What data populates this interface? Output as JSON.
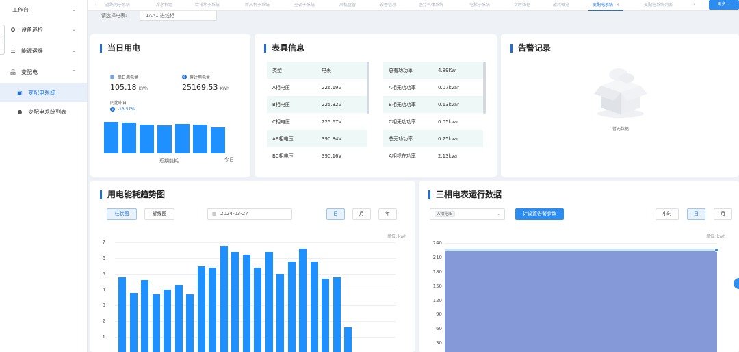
{
  "sidebar": {
    "workbench": "工作台",
    "items": [
      {
        "label": "设备巡检",
        "icon": "gear-icon"
      },
      {
        "label": "能源运维",
        "icon": "list-icon"
      },
      {
        "label": "变配电",
        "icon": "network-icon"
      }
    ],
    "sub_items": [
      {
        "label": "变配电系统",
        "active": true
      },
      {
        "label": "变配电系统列表",
        "active": false
      }
    ]
  },
  "tabs": [
    "道路网子系统",
    "冷水机组",
    "给排水子系统",
    "新风机子系统",
    "空调子系统",
    "风机盘管",
    "设备信息",
    "医疗气体系统",
    "电梯子系统",
    "实时数据",
    "能耗概览",
    "变配电系统",
    "变配电系统列表"
  ],
  "active_tab": "变配电系统",
  "more_label": "更多",
  "filter": {
    "label": "请选择电表:",
    "value": "1AA1 进线柜"
  },
  "daily": {
    "title": "当日用电",
    "single_label": "单日用电量",
    "single_value": "105.18",
    "single_unit": "KWh",
    "total_label": "累计用电量",
    "total_value": "25169.53",
    "total_unit": "KWh",
    "yoy_label": "同比昨日",
    "yoy_value": "-13.57%",
    "bar_values": [
      105,
      104,
      96,
      94,
      99,
      96,
      87
    ],
    "recent_label": "近期能耗",
    "today_label": "今日"
  },
  "meter": {
    "title": "表具信息",
    "left_header": [
      "类型",
      "电表"
    ],
    "left_rows": [
      [
        "A相电压",
        "226.19V"
      ],
      [
        "B相电压",
        "225.32V"
      ],
      [
        "C相电压",
        "225.67V"
      ],
      [
        "AB相电压",
        "390.84V"
      ],
      [
        "BC相电压",
        "390.16V"
      ]
    ],
    "right_rows": [
      [
        "总有功功率",
        "4.89Kw"
      ],
      [
        "A相无功功率",
        "0.07kvar"
      ],
      [
        "B相无功功率",
        "0.13kvar"
      ],
      [
        "C相无功功率",
        "0.05kvar"
      ],
      [
        "总无功功率",
        "0.25kvar"
      ],
      [
        "A相视在功率",
        "2.13kva"
      ]
    ]
  },
  "alarm": {
    "title": "告警记录",
    "empty_text": "暂无数据"
  },
  "trend": {
    "title": "用电能耗趋势图",
    "btn_bar": "柱状图",
    "btn_line": "折线图",
    "date": "2024-03-27",
    "btn_day": "日",
    "btn_month": "月",
    "btn_year": "年",
    "unit": "单位: kwh"
  },
  "three_phase": {
    "title": "三相电表运行数据",
    "select_chip": "A相电压",
    "config_btn": "计设置告警参数",
    "btn_hour": "小时",
    "btn_day": "日",
    "btn_month": "月",
    "unit": "单位: kwh"
  },
  "chart_data": [
    {
      "type": "bar",
      "title": "用电能耗趋势图",
      "ylabel": "单位: kwh",
      "ylim": [
        0,
        7
      ],
      "yticks": [
        1,
        2,
        3,
        4,
        5,
        6,
        7
      ],
      "values": [
        4.8,
        3.8,
        4.6,
        3.7,
        4.0,
        4.3,
        3.7,
        5.5,
        5.4,
        6.8,
        6.4,
        6.2,
        5.4,
        6.4,
        5.0,
        5.8,
        6.6,
        5.8,
        4.7,
        4.8,
        1.6
      ],
      "color": "#1e90ff"
    },
    {
      "type": "area",
      "title": "三相电表运行数据",
      "series_label": "A相电压",
      "ylabel": "单位: kwh",
      "ylim": [
        0,
        240
      ],
      "yticks": [
        30,
        60,
        90,
        120,
        150,
        180,
        210,
        240
      ],
      "values": [
        226,
        225,
        226,
        226,
        225,
        226,
        226
      ],
      "color": "#8599d8"
    }
  ]
}
